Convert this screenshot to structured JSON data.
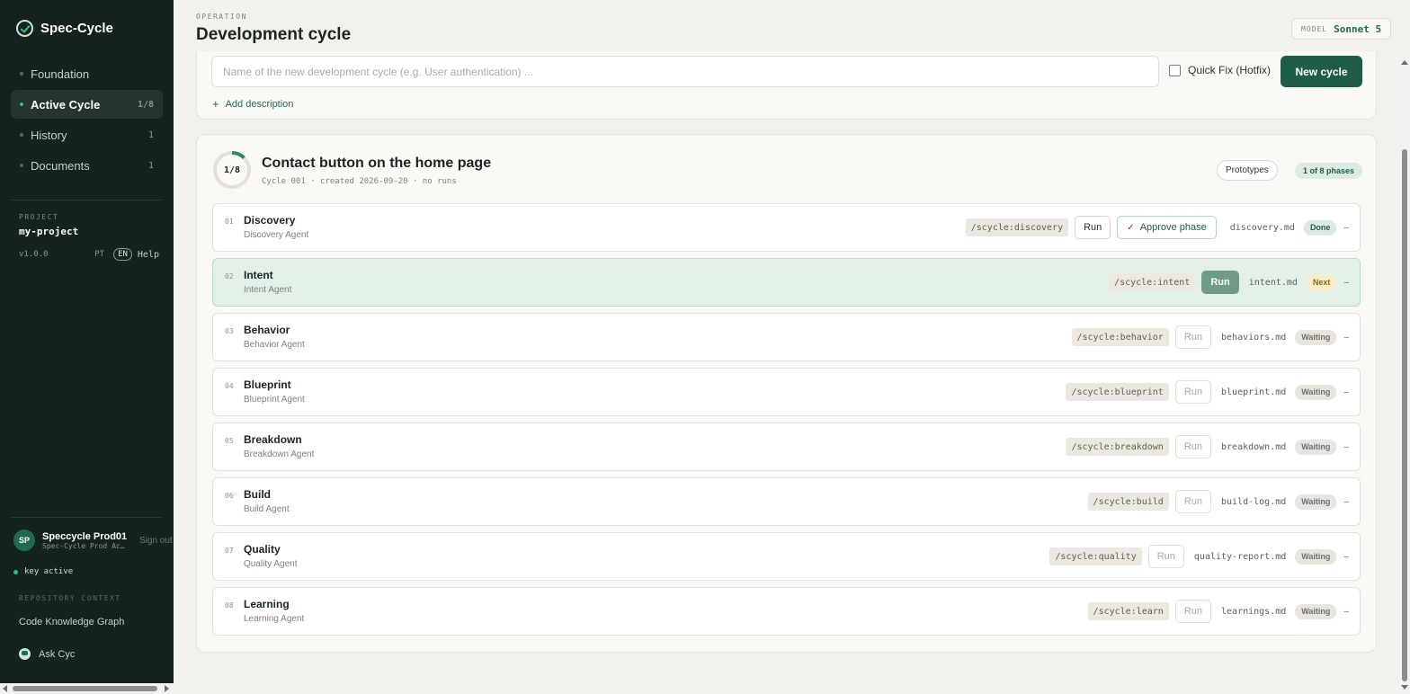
{
  "sidebar": {
    "brand": "Spec-Cycle",
    "items": [
      {
        "label": "Foundation",
        "count": ""
      },
      {
        "label": "Active Cycle",
        "count": "1/8"
      },
      {
        "label": "History",
        "count": "1"
      },
      {
        "label": "Documents",
        "count": "1"
      }
    ],
    "project_caption": "PROJECT",
    "project_name": "my-project",
    "version": "v1.0.0",
    "lang_pt": "PT",
    "lang_en": "EN",
    "help": "Help",
    "user": {
      "initials": "SP",
      "name": "Speccycle Prod01",
      "sub": "Spec-Cycle Prod Ac…",
      "signout": "Sign out"
    },
    "key_status": "key active",
    "repo_caption": "REPOSITORY CONTEXT",
    "code_graph": "Code Knowledge Graph",
    "ask": "Ask Cyc"
  },
  "header": {
    "caption": "OPERATION",
    "title": "Development cycle",
    "model_label": "MODEL",
    "model_value": "Sonnet 5"
  },
  "new_cycle": {
    "placeholder": "Name of the new development cycle (e.g. User authentication) ...",
    "hotfix_label": "Quick Fix (Hotfix)",
    "button": "New cycle",
    "add_description": "Add description"
  },
  "cycle": {
    "progress_text": "1/8",
    "progress_fraction": 0.125,
    "title": "Contact button on the home page",
    "meta": "Cycle 001 · created 2026-09-20 · no runs",
    "prototypes": "Prototypes",
    "phase_badge": "1 of 8 phases",
    "phases": [
      {
        "num": "01",
        "name": "Discovery",
        "agent": "Discovery Agent",
        "cmd": "/scycle:discovery",
        "run": "Run",
        "approve": "Approve phase",
        "file": "discovery.md",
        "status": "Done",
        "dash": "–"
      },
      {
        "num": "02",
        "name": "Intent",
        "agent": "Intent Agent",
        "cmd": "/scycle:intent",
        "run": "Run",
        "file": "intent.md",
        "status": "Next",
        "dash": "–"
      },
      {
        "num": "03",
        "name": "Behavior",
        "agent": "Behavior Agent",
        "cmd": "/scycle:behavior",
        "run": "Run",
        "file": "behaviors.md",
        "status": "Waiting",
        "dash": "–"
      },
      {
        "num": "04",
        "name": "Blueprint",
        "agent": "Blueprint Agent",
        "cmd": "/scycle:blueprint",
        "run": "Run",
        "file": "blueprint.md",
        "status": "Waiting",
        "dash": "–"
      },
      {
        "num": "05",
        "name": "Breakdown",
        "agent": "Breakdown Agent",
        "cmd": "/scycle:breakdown",
        "run": "Run",
        "file": "breakdown.md",
        "status": "Waiting",
        "dash": "–"
      },
      {
        "num": "06",
        "name": "Build",
        "agent": "Build Agent",
        "cmd": "/scycle:build",
        "run": "Run",
        "file": "build-log.md",
        "status": "Waiting",
        "dash": "–"
      },
      {
        "num": "07",
        "name": "Quality",
        "agent": "Quality Agent",
        "cmd": "/scycle:quality",
        "run": "Run",
        "file": "quality-report.md",
        "status": "Waiting",
        "dash": "–"
      },
      {
        "num": "08",
        "name": "Learning",
        "agent": "Learning Agent",
        "cmd": "/scycle:learn",
        "run": "Run",
        "file": "learnings.md",
        "status": "Waiting",
        "dash": "–"
      }
    ]
  }
}
